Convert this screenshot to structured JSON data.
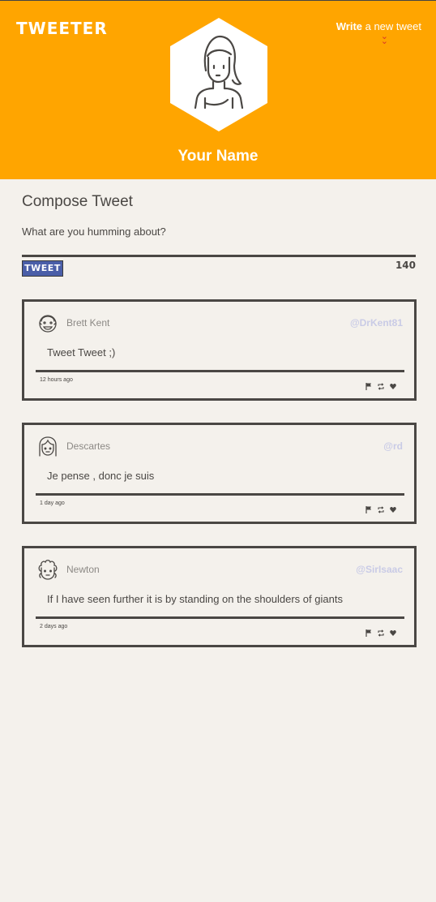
{
  "header": {
    "brand": "TWEETER",
    "write_bold": "Write",
    "write_rest": " a new tweet",
    "profile_name": "Your Name",
    "accent_color": "#ffa500"
  },
  "compose": {
    "title": "Compose Tweet",
    "prompt": "What are you humming about?",
    "tweet_button": "TWEET",
    "char_counter": "140"
  },
  "tweets": [
    {
      "author": "Brett Kent",
      "handle": "@DrKent81",
      "text": "Tweet Tweet ;)",
      "time": "12 hours ago",
      "avatar_icon": "smiling-man-avatar-icon"
    },
    {
      "author": "Descartes",
      "handle": "@rd",
      "text": "Je pense , donc je suis",
      "time": "1 day ago",
      "avatar_icon": "long-hair-avatar-icon"
    },
    {
      "author": "Newton",
      "handle": "@SirIsaac",
      "text": "If I have seen further it is by standing on the shoulders of giants",
      "time": "2 days ago",
      "avatar_icon": "curly-hair-avatar-icon"
    }
  ],
  "icons": {
    "flag": "flag-icon",
    "retweet": "retweet-icon",
    "like": "heart-icon"
  }
}
